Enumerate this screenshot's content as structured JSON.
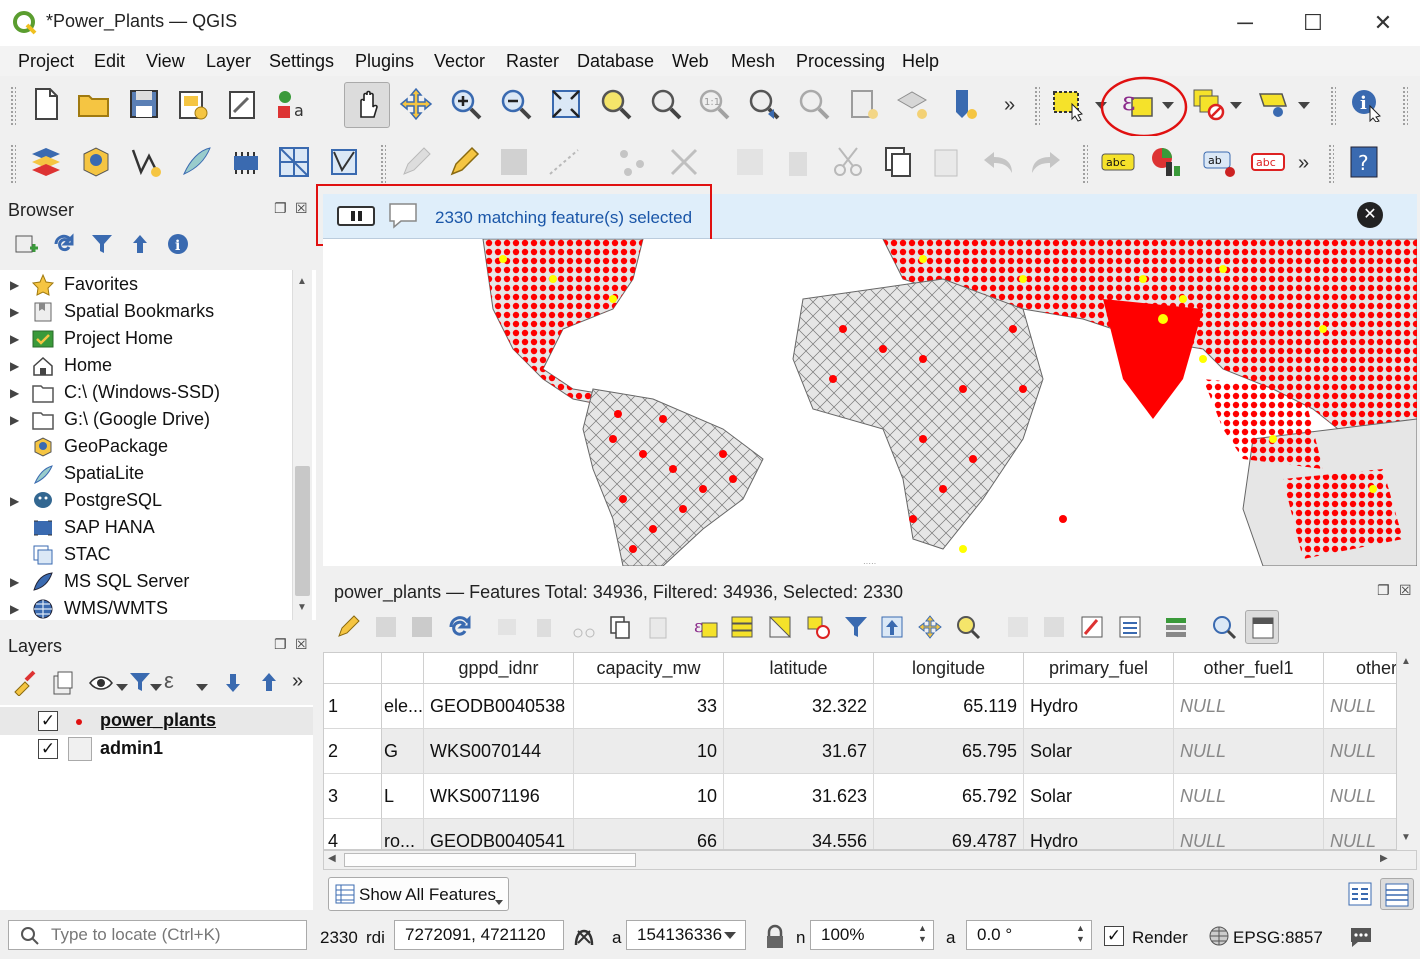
{
  "window": {
    "title": "*Power_Plants — QGIS",
    "minimize": "─",
    "maximize": "☐",
    "close": "✕"
  },
  "menu": [
    "Project",
    "Edit",
    "View",
    "Layer",
    "Settings",
    "Plugins",
    "Vector",
    "Raster",
    "Database",
    "Web",
    "Mesh",
    "Processing",
    "Help"
  ],
  "toolbar_more": "»",
  "browser": {
    "title": "Browser",
    "items": [
      {
        "label": "Favorites",
        "icon": "star-icon",
        "expandable": true
      },
      {
        "label": "Spatial Bookmarks",
        "icon": "bookmark-icon",
        "expandable": true
      },
      {
        "label": "Project Home",
        "icon": "project-home-icon",
        "expandable": true
      },
      {
        "label": "Home",
        "icon": "home-icon",
        "expandable": true
      },
      {
        "label": "C:\\ (Windows-SSD)",
        "icon": "folder-icon",
        "expandable": true
      },
      {
        "label": "G:\\ (Google Drive)",
        "icon": "folder-icon",
        "expandable": true
      },
      {
        "label": "GeoPackage",
        "icon": "geopackage-icon",
        "expandable": false
      },
      {
        "label": "SpatiaLite",
        "icon": "spatialite-icon",
        "expandable": false
      },
      {
        "label": "PostgreSQL",
        "icon": "postgresql-icon",
        "expandable": true
      },
      {
        "label": "SAP HANA",
        "icon": "sap-hana-icon",
        "expandable": false
      },
      {
        "label": "STAC",
        "icon": "stac-icon",
        "expandable": false
      },
      {
        "label": "MS SQL Server",
        "icon": "mssql-icon",
        "expandable": true
      },
      {
        "label": "WMS/WMTS",
        "icon": "wms-icon",
        "expandable": true
      }
    ]
  },
  "layers": {
    "title": "Layers",
    "items": [
      {
        "label": "power_plants",
        "checked": true,
        "active": true
      },
      {
        "label": "admin1",
        "checked": true,
        "active": false
      }
    ]
  },
  "message_bar": {
    "text": "2330 matching feature(s) selected"
  },
  "attribute_table": {
    "title": "power_plants — Features Total: 34936, Filtered: 34936, Selected: 2330",
    "columns": [
      "gppd_idnr",
      "capacity_mw",
      "latitude",
      "longitude",
      "primary_fuel",
      "other_fuel1",
      "other"
    ],
    "rows": [
      {
        "n": "1",
        "prev": "ele...",
        "cells": [
          "GEODB0040538",
          "33",
          "32.322",
          "65.119",
          "Hydro",
          "NULL",
          "NULL"
        ]
      },
      {
        "n": "2",
        "prev": "G",
        "cells": [
          "WKS0070144",
          "10",
          "31.67",
          "65.795",
          "Solar",
          "NULL",
          "NULL"
        ]
      },
      {
        "n": "3",
        "prev": "L",
        "cells": [
          "WKS0071196",
          "10",
          "31.623",
          "65.792",
          "Solar",
          "NULL",
          "NULL"
        ]
      },
      {
        "n": "4",
        "prev": "ro...",
        "cells": [
          "GEODB0040541",
          "66",
          "34.556",
          "69.4787",
          "Hydro",
          "NULL",
          "NULL"
        ]
      }
    ],
    "show_all": "Show All Features"
  },
  "status": {
    "locator_placeholder": "Type to locate (Ctrl+K)",
    "count": "2330",
    "coord_label": "rdi",
    "coordinate": "7272091, 4721120",
    "scale_label": "a",
    "scale": "154136336",
    "magnifier_label": "n",
    "magnifier": "100%",
    "rotation_label": "a",
    "rotation": "0.0 °",
    "render": "Render",
    "crs": "EPSG:8857"
  },
  "colors": {
    "selection_yellow": "#ffff00",
    "points_red": "#ff0000",
    "land_grey": "#e6e6e6",
    "annotation_red": "#e01010",
    "message_blue": "#1a56a8"
  }
}
